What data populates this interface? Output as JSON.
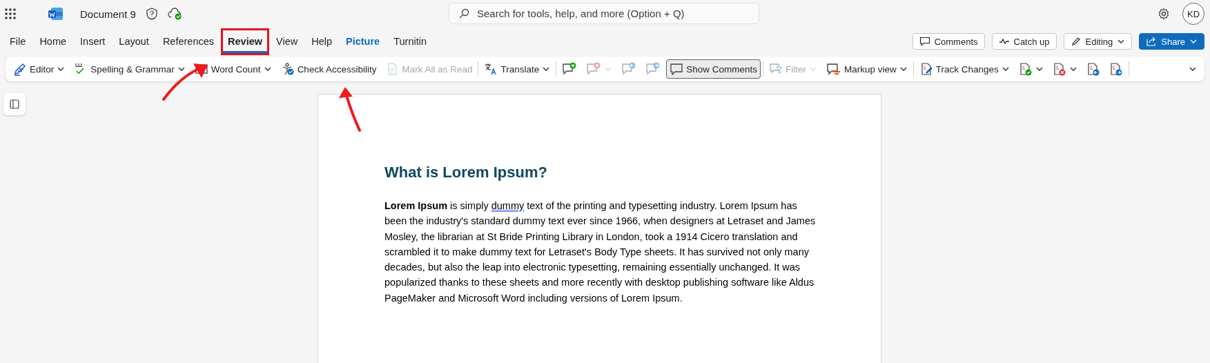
{
  "top_bar": {
    "document_title": "Document 9",
    "search": {
      "placeholder": "Search for tools, help, and more (Option + Q)"
    },
    "avatar": "KD"
  },
  "menu": {
    "tabs": [
      {
        "label": "File",
        "selected": false,
        "kind": "normal",
        "highlighted": false
      },
      {
        "label": "Home",
        "selected": false,
        "kind": "normal",
        "highlighted": false
      },
      {
        "label": "Insert",
        "selected": false,
        "kind": "normal",
        "highlighted": false
      },
      {
        "label": "Layout",
        "selected": false,
        "kind": "normal",
        "highlighted": false
      },
      {
        "label": "References",
        "selected": false,
        "kind": "normal",
        "highlighted": false
      },
      {
        "label": "Review",
        "selected": true,
        "kind": "normal",
        "highlighted": true
      },
      {
        "label": "View",
        "selected": false,
        "kind": "normal",
        "highlighted": false
      },
      {
        "label": "Help",
        "selected": false,
        "kind": "normal",
        "highlighted": false
      },
      {
        "label": "Picture",
        "selected": false,
        "kind": "context",
        "highlighted": false
      },
      {
        "label": "Turnitin",
        "selected": false,
        "kind": "normal",
        "highlighted": false
      }
    ],
    "actions": [
      {
        "label": "Comments",
        "kind": "outline",
        "dropdown": false
      },
      {
        "label": "Catch up",
        "kind": "outline",
        "dropdown": false
      },
      {
        "label": "Editing",
        "kind": "outline",
        "dropdown": true
      },
      {
        "label": "Share",
        "kind": "primary",
        "dropdown": true
      }
    ]
  },
  "ribbon": {
    "items": [
      {
        "kind": "button",
        "label": "Editor",
        "dropdown": true,
        "disabled": false,
        "pressed": false
      },
      {
        "kind": "button",
        "label": "Spelling & Grammar",
        "dropdown": true,
        "disabled": false,
        "pressed": false
      },
      {
        "kind": "button",
        "label": "Word Count",
        "dropdown": true,
        "disabled": false,
        "pressed": false
      },
      {
        "kind": "button",
        "label": "Check Accessibility",
        "dropdown": false,
        "disabled": false,
        "pressed": false
      },
      {
        "kind": "button",
        "label": "Mark All as Read",
        "dropdown": false,
        "disabled": true,
        "pressed": false
      },
      {
        "kind": "separator"
      },
      {
        "kind": "button",
        "label": "Translate",
        "dropdown": true,
        "disabled": false,
        "pressed": false
      },
      {
        "kind": "separator"
      },
      {
        "kind": "icon",
        "dropdown": false,
        "disabled": false,
        "pressed": false
      },
      {
        "kind": "icon",
        "dropdown": true,
        "disabled": true,
        "pressed": false
      },
      {
        "kind": "icon",
        "dropdown": false,
        "disabled": true,
        "pressed": false
      },
      {
        "kind": "icon",
        "dropdown": false,
        "disabled": true,
        "pressed": false
      },
      {
        "kind": "button",
        "label": "Show Comments",
        "dropdown": false,
        "disabled": false,
        "pressed": true
      },
      {
        "kind": "separator"
      },
      {
        "kind": "button",
        "label": "Filter",
        "dropdown": true,
        "disabled": true,
        "pressed": false
      },
      {
        "kind": "button",
        "label": "Markup view",
        "dropdown": true,
        "disabled": false,
        "pressed": false
      },
      {
        "kind": "separator"
      },
      {
        "kind": "button",
        "label": "Track Changes",
        "dropdown": true,
        "disabled": false,
        "pressed": false
      },
      {
        "kind": "icon",
        "dropdown": true,
        "disabled": false,
        "pressed": false
      },
      {
        "kind": "icon",
        "dropdown": true,
        "disabled": false,
        "pressed": false
      },
      {
        "kind": "icon",
        "dropdown": false,
        "disabled": false,
        "pressed": false
      },
      {
        "kind": "icon",
        "dropdown": false,
        "disabled": false,
        "pressed": false
      },
      {
        "kind": "separator"
      },
      {
        "kind": "overflow"
      }
    ]
  },
  "document": {
    "heading": "What is Lorem Ipsum?",
    "paragraph": [
      {
        "text": "Lorem Ipsum",
        "kind": "bold"
      },
      {
        "text": " is simply ",
        "kind": "plain"
      },
      {
        "text": "dummy",
        "kind": "flagged"
      },
      {
        "text": " text of the printing and typesetting industry. Lorem Ipsum has been the industry's standard dummy text ever since 1966, when designers at Letraset and James Mosley, the librarian at St Bride Printing Library in London, took a 1914 Cicero translation and scrambled it to make dummy text for Letraset's Body Type sheets. It has survived not only many decades, but also the leap into electronic typesetting, remaining essentially unchanged. It was popularized thanks to these sheets and more recently with desktop publishing software like Aldus PageMaker and Microsoft Word including versions of Lorem Ipsum.",
        "kind": "plain"
      }
    ]
  },
  "annotations": [
    {
      "kind": "arrow"
    },
    {
      "kind": "arrow"
    }
  ]
}
